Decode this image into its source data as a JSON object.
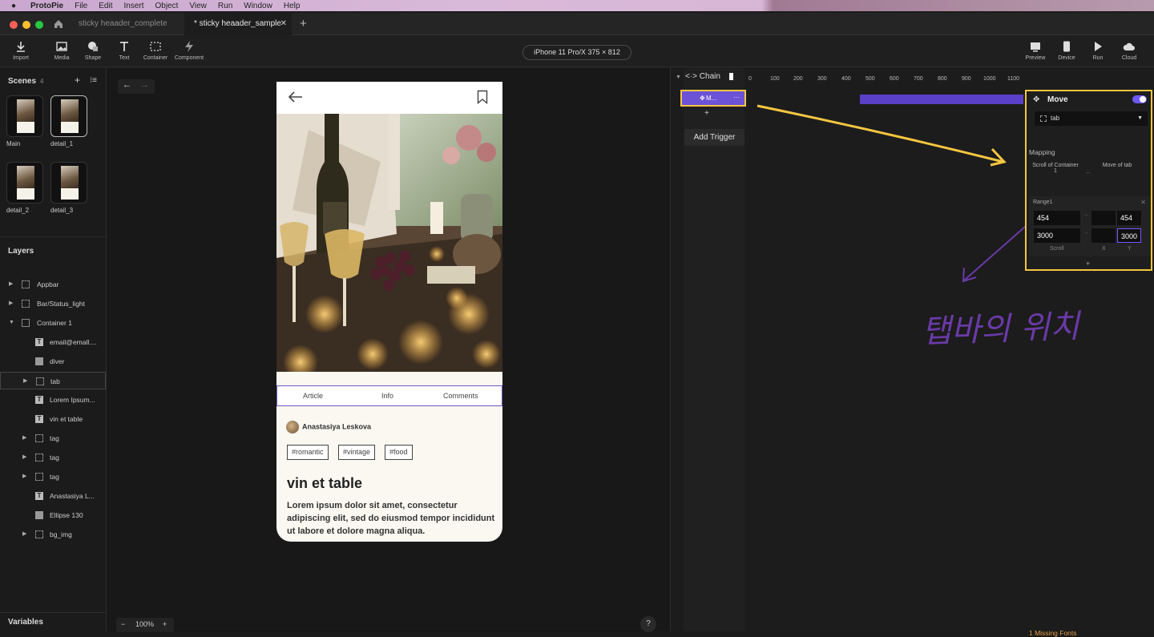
{
  "menubar": {
    "app_name": "ProtoPie",
    "items": [
      "File",
      "Edit",
      "Insert",
      "Object",
      "View",
      "Run",
      "Window",
      "Help"
    ]
  },
  "tabs": [
    {
      "label": "sticky heaader_complete",
      "active": false
    },
    {
      "label": "* sticky heaader_sample",
      "active": true
    }
  ],
  "toolbar": {
    "left_tools": [
      "Import",
      "Media",
      "Shape",
      "Text",
      "Container",
      "Component"
    ],
    "device": "iPhone 11 Pro/X  375 × 812",
    "right_tools": [
      "Preview",
      "Device",
      "Run",
      "Cloud"
    ]
  },
  "scenes": {
    "title": "Scenes",
    "count": "4",
    "items": [
      "Main",
      "detail_1",
      "detail_2",
      "detail_3"
    ]
  },
  "layers": {
    "title": "Layers",
    "items": [
      {
        "name": "Appbar",
        "type": "frame"
      },
      {
        "name": "Bar/Status_light",
        "type": "frame"
      },
      {
        "name": "Container 1",
        "type": "container"
      },
      {
        "name": "email@emall....",
        "type": "text"
      },
      {
        "name": "diver",
        "type": "image"
      },
      {
        "name": "tab",
        "type": "frame"
      },
      {
        "name": "Lorem Ipsum...",
        "type": "text"
      },
      {
        "name": "vin et table",
        "type": "text"
      },
      {
        "name": "tag",
        "type": "frame"
      },
      {
        "name": "tag",
        "type": "frame"
      },
      {
        "name": "tag",
        "type": "frame"
      },
      {
        "name": "Anastasiya L...",
        "type": "text"
      },
      {
        "name": "Ellipse 130",
        "type": "image"
      },
      {
        "name": "bg_img",
        "type": "frame"
      }
    ]
  },
  "variables": {
    "title": "Variables"
  },
  "canvas": {
    "zoom": "100%",
    "help": "?"
  },
  "phone": {
    "tabs": [
      "Article",
      "Info",
      "Comments"
    ],
    "author": "Anastasiya Leskova",
    "tags": [
      "#romantic",
      "#vintage",
      "#food"
    ],
    "title": "vin et table",
    "body": "Lorem ipsum dolor sit amet, consectetur adipiscing elit, sed do eiusmod tempor incididunt ut labore et dolore magna aliqua."
  },
  "timeline": {
    "chain_label": "Chain",
    "trigger_row": "M...",
    "add_trigger": "Add Trigger",
    "ticks": [
      "0",
      "100",
      "200",
      "300",
      "400",
      "500",
      "600",
      "700",
      "800",
      "900",
      "1000",
      "1100"
    ],
    "missing_fonts": "1 Missing Fonts"
  },
  "response_panel": {
    "title": "Move",
    "enabled": true,
    "target": "tab",
    "mapping_label": "Mapping",
    "mapping_from": "Scroll of Container 1",
    "mapping_to": "Move of tab",
    "range_label": "Range1",
    "scroll_from": "454",
    "scroll_to": "3000",
    "y_from": "454",
    "y_to": "3000",
    "col_labels": [
      "Scroll",
      "X",
      "Y"
    ],
    "add": "+"
  },
  "annotation": {
    "text": "탭바의 위치",
    "color": "#6a3aa8",
    "highlight_color": "#f5c640"
  }
}
